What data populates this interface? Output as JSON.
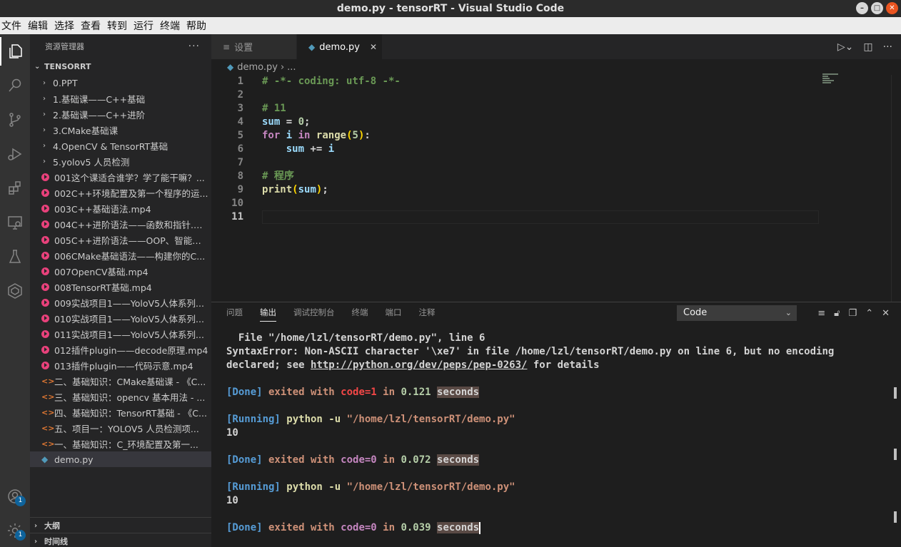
{
  "window": {
    "title": "demo.py - tensorRT - Visual Studio Code"
  },
  "menu": [
    "文件",
    "编辑",
    "选择",
    "查看",
    "转到",
    "运行",
    "终端",
    "帮助"
  ],
  "activity": {
    "account_badge": "1",
    "settings_badge": "1"
  },
  "sidebar": {
    "title": "资源管理器",
    "more": "···",
    "root": "TENSORRT",
    "items": [
      {
        "kind": "folder",
        "label": "0.PPT"
      },
      {
        "kind": "folder",
        "label": "1.基础课——C++基础"
      },
      {
        "kind": "folder",
        "label": "2.基础课——C++进阶"
      },
      {
        "kind": "folder",
        "label": "3.CMake基础课"
      },
      {
        "kind": "folder",
        "label": "4.OpenCV & TensorRT基础"
      },
      {
        "kind": "folder",
        "label": "5.yolov5 人员检测"
      },
      {
        "kind": "mp4",
        "label": "001这个课适合谁学？学了能干嘛？..."
      },
      {
        "kind": "mp4",
        "label": "002C++环境配置及第一个程序的运..."
      },
      {
        "kind": "mp4",
        "label": "003C++基础语法.mp4"
      },
      {
        "kind": "mp4",
        "label": "004C++进阶语法——函数和指针.mp4"
      },
      {
        "kind": "mp4",
        "label": "005C++进阶语法——OOP、智能指..."
      },
      {
        "kind": "mp4",
        "label": "006CMake基础语法——构建你的C..."
      },
      {
        "kind": "mp4",
        "label": "007OpenCV基础.mp4"
      },
      {
        "kind": "mp4",
        "label": "008TensorRT基础.mp4"
      },
      {
        "kind": "mp4",
        "label": "009实战项目1——YoloV5人体系列..."
      },
      {
        "kind": "mp4",
        "label": "010实战项目1——YoloV5人体系列..."
      },
      {
        "kind": "mp4",
        "label": "011实战项目1——YoloV5人体系列..."
      },
      {
        "kind": "mp4",
        "label": "012插件plugin——decode原理.mp4"
      },
      {
        "kind": "mp4",
        "label": "013插件plugin——代码示意.mp4"
      },
      {
        "kind": "html",
        "label": "二、基础知识：CMake基础课 - 《C..."
      },
      {
        "kind": "html",
        "label": "三、基础知识：opencv 基本用法 - ..."
      },
      {
        "kind": "html",
        "label": "四、基础知识：TensorRT基础 - 《C..."
      },
      {
        "kind": "html",
        "label": "五、项目一：YOLOV5 人员检测项..."
      },
      {
        "kind": "html",
        "label": "一、基础知识：C_环境配置及第一..."
      },
      {
        "kind": "py",
        "label": "demo.py",
        "selected": true
      }
    ],
    "outline": "大纲",
    "timeline": "时间线"
  },
  "tabs": [
    {
      "label": "设置",
      "icon": "settings-file-icon"
    },
    {
      "label": "demo.py",
      "icon": "python-file-icon",
      "close": "✕"
    }
  ],
  "breadcrumb": {
    "file": "demo.py",
    "rest": "..."
  },
  "editor": {
    "current_line": 11,
    "lines": [
      {
        "n": "1",
        "t": [
          [
            "c-com",
            "# -*- coding: utf-8 -*-"
          ]
        ]
      },
      {
        "n": "2",
        "t": []
      },
      {
        "n": "3",
        "t": [
          [
            "c-com",
            "# 11"
          ]
        ]
      },
      {
        "n": "4",
        "t": [
          [
            "c-var",
            "sum"
          ],
          [
            "c-op",
            " = "
          ],
          [
            "c-num",
            "0"
          ],
          [
            "c-semi",
            ";"
          ]
        ]
      },
      {
        "n": "5",
        "t": [
          [
            "c-kw",
            "for"
          ],
          [
            "c-op",
            " "
          ],
          [
            "c-var",
            "i"
          ],
          [
            "c-op",
            " "
          ],
          [
            "c-kw",
            "in"
          ],
          [
            "c-op",
            " "
          ],
          [
            "c-fn",
            "range"
          ],
          [
            "c-br",
            "("
          ],
          [
            "c-num",
            "5"
          ],
          [
            "c-br",
            ")"
          ],
          [
            "c-op",
            ":"
          ]
        ]
      },
      {
        "n": "6",
        "t": [
          [
            "c-op",
            "    "
          ],
          [
            "c-var",
            "sum"
          ],
          [
            "c-op",
            " += "
          ],
          [
            "c-var",
            "i"
          ]
        ]
      },
      {
        "n": "7",
        "t": []
      },
      {
        "n": "8",
        "t": [
          [
            "c-com",
            "# 程序"
          ]
        ]
      },
      {
        "n": "9",
        "t": [
          [
            "c-fn",
            "print"
          ],
          [
            "c-br",
            "("
          ],
          [
            "c-var",
            "sum"
          ],
          [
            "c-br",
            ")"
          ],
          [
            "c-semi",
            ";"
          ]
        ]
      },
      {
        "n": "10",
        "t": []
      },
      {
        "n": "11",
        "t": []
      }
    ]
  },
  "panel": {
    "tabs": [
      "问题",
      "输出",
      "调试控制台",
      "终端",
      "端口",
      "注释"
    ],
    "active_tab": "输出",
    "channel": "Code",
    "output": [
      [
        [
          "",
          "  File \"/home/lzl/tensorRT/demo.py\", line 6"
        ]
      ],
      [
        [
          "",
          "SyntaxError: Non-ASCII character '\\xe7' in file /home/lzl/tensorRT/demo.py on line 6, but no encoding"
        ]
      ],
      [
        [
          "",
          "declared; see "
        ],
        [
          "o-link",
          "http://python.org/dev/peps/pep-0263/"
        ],
        [
          "",
          " for details"
        ]
      ],
      [],
      [
        [
          "o-tag",
          "[Done]"
        ],
        [
          "o-done",
          " exited with "
        ],
        [
          "o-red",
          "code=1"
        ],
        [
          "o-done",
          " in "
        ],
        [
          "o-num",
          "0.121"
        ],
        [
          "",
          " "
        ],
        [
          "o-hl",
          "seconds"
        ]
      ],
      [],
      [
        [
          "o-tag",
          "[Running]"
        ],
        [
          "o-cmd",
          " python -u "
        ],
        [
          "o-str",
          "\"/home/lzl/tensorRT/demo.py\""
        ]
      ],
      [
        [
          "",
          "10"
        ]
      ],
      [],
      [
        [
          "o-tag",
          "[Done]"
        ],
        [
          "o-done",
          " exited with "
        ],
        [
          "o-code",
          "code=0"
        ],
        [
          "o-done",
          " in "
        ],
        [
          "o-num",
          "0.072"
        ],
        [
          "",
          " "
        ],
        [
          "o-hl",
          "seconds"
        ]
      ],
      [],
      [
        [
          "o-tag",
          "[Running]"
        ],
        [
          "o-cmd",
          " python -u "
        ],
        [
          "o-str",
          "\"/home/lzl/tensorRT/demo.py\""
        ]
      ],
      [
        [
          "",
          "10"
        ]
      ],
      [],
      [
        [
          "o-tag",
          "[Done]"
        ],
        [
          "o-done",
          " exited with "
        ],
        [
          "o-code",
          "code=0"
        ],
        [
          "o-done",
          " in "
        ],
        [
          "o-num",
          "0.039"
        ],
        [
          "",
          " "
        ],
        [
          "o-hl",
          "seconds"
        ]
      ]
    ]
  }
}
